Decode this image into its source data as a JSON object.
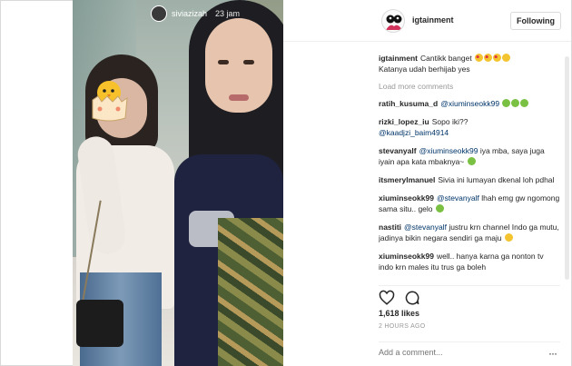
{
  "story": {
    "username": "siviazizah",
    "time": "23 jam"
  },
  "post": {
    "author": "igtainment",
    "follow_label": "Following",
    "likes": "1,618 likes",
    "time_ago": "2 HOURS AGO",
    "add_comment_placeholder": "Add a comment...",
    "more_label": "···"
  },
  "caption": {
    "user": "igtainment",
    "text": "Cantikk banget",
    "text2": "Katanya udah berhijab yes"
  },
  "load_more": "Load more comments",
  "comments": [
    {
      "user": "ratih_kusuma_d",
      "mention": "@xiuminseokk99",
      "text": ""
    },
    {
      "user": "rizki_lopez_iu",
      "text": "Sopo iki??",
      "mention": "@kaadjzi_baim4914"
    },
    {
      "user": "stevanyalf",
      "mention": "@xiuminseokk99",
      "text": "iya mba, saya juga iyain apa kata mbaknya~"
    },
    {
      "user": "itsmerylmanuel",
      "text": "Sivia ini lumayan dkenal loh pdhal"
    },
    {
      "user": "xiuminseokk99",
      "mention": "@stevanyalf",
      "text": "lhah emg gw ngomong sama situ.. gelo"
    },
    {
      "user": "nastiti",
      "mention": "@stevanyalf",
      "text": "justru krn channel Indo ga mutu, jadinya bikin negara sendiri ga maju"
    },
    {
      "user": "xiuminseokk99",
      "text": "well.. hanya karna ga nonton tv indo krn males itu trus ga boleh"
    }
  ],
  "icons": {
    "like": "heart-outline-icon",
    "comment": "speech-bubble-icon",
    "more": "ellipsis-icon"
  },
  "colors": {
    "link": "#003569",
    "muted": "#999999",
    "border": "#efefef"
  }
}
